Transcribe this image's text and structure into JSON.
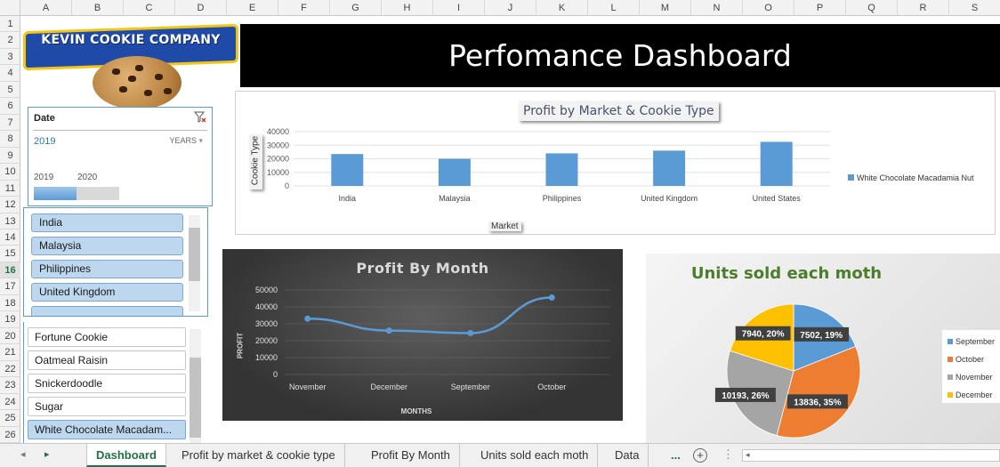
{
  "columns": [
    "A",
    "B",
    "C",
    "D",
    "E",
    "F",
    "G",
    "H",
    "I",
    "J",
    "K",
    "L",
    "M",
    "N",
    "O",
    "P",
    "Q",
    "R",
    "S"
  ],
  "rows": [
    "1",
    "2",
    "3",
    "4",
    "5",
    "6",
    "7",
    "8",
    "9",
    "10",
    "11",
    "12",
    "13",
    "14",
    "15",
    "16",
    "17",
    "18",
    "19",
    "20",
    "21",
    "22",
    "23",
    "24",
    "25",
    "26"
  ],
  "selected_row": "16",
  "logo_text": "KEVIN COOKIE COMPANY",
  "dashboard_title": "Perfomance Dashboard",
  "date_slicer": {
    "header": "Date",
    "selection": "2019",
    "level": "YEARS",
    "years": [
      "2019",
      "2020"
    ]
  },
  "market_slicer": {
    "items": [
      "India",
      "Malaysia",
      "Philippines",
      "United Kingdom"
    ]
  },
  "cookie_slicer": {
    "items": [
      "Fortune Cookie",
      "Oatmeal Raisin",
      "Snickerdoodle",
      "Sugar",
      "White Chocolate Macadam..."
    ]
  },
  "chart_data": [
    {
      "type": "bar",
      "title": "Profit by Market & Cookie Type",
      "xlabel": "Market",
      "ylabel": "Cookie Type",
      "categories": [
        "India",
        "Malaysia",
        "Philippines",
        "United Kingdom",
        "United States"
      ],
      "series": [
        {
          "name": "White Chocolate Macadamia Nut",
          "values": [
            23500,
            20000,
            24000,
            26000,
            32500
          ]
        }
      ],
      "ylim": [
        0,
        40000
      ],
      "yticks": [
        0,
        10000,
        20000,
        30000,
        40000
      ],
      "legend": "right",
      "grid": true,
      "color": "#5b9bd5"
    },
    {
      "type": "line",
      "title": "Profit By Month",
      "xlabel": "MONTHS",
      "ylabel": "PROFIT",
      "categories": [
        "November",
        "December",
        "September",
        "October"
      ],
      "values": [
        33000,
        26000,
        24500,
        45500
      ],
      "ylim": [
        0,
        50000
      ],
      "yticks": [
        0,
        10000,
        20000,
        30000,
        40000,
        50000
      ],
      "grid": true,
      "color": "#5b9bd5"
    },
    {
      "type": "pie",
      "title": "Units sold each moth",
      "categories": [
        "September",
        "October",
        "November",
        "December"
      ],
      "values": [
        7502,
        13836,
        10193,
        7940
      ],
      "labels": [
        "7502, 19%",
        "13836, 35%",
        "10193, 26%",
        "7940, 20%"
      ],
      "colors": [
        "#5b9bd5",
        "#ed7d31",
        "#a5a5a5",
        "#ffc000"
      ],
      "legend": "right"
    }
  ],
  "tabs": {
    "labels": [
      "Dashboard",
      "Profit by market & cookie type",
      "Profit By Month",
      "Units sold each moth",
      "Data"
    ],
    "active": "Dashboard",
    "more": "...",
    "add": "+"
  }
}
